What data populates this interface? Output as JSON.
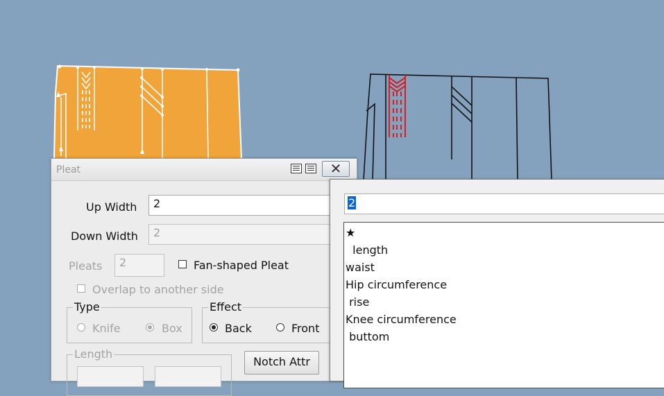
{
  "dialog": {
    "title": "Pleat",
    "up_width_label": "Up Width",
    "up_width_value": "2",
    "down_width_label": "Down Width",
    "down_width_value": "2",
    "pleats_label": "Pleats",
    "pleats_value": "2",
    "fan_shaped_label": "Fan-shaped Pleat",
    "overlap_label": "Overlap to another side",
    "type_label": "Type",
    "type_options": [
      "Knife",
      "Box"
    ],
    "type_selected": "Box",
    "effect_label": "Effect",
    "effect_options": [
      "Back",
      "Front"
    ],
    "effect_selected": "Back",
    "length_label": "Length",
    "notch_attr_label": "Notch Attr"
  },
  "popup": {
    "input_value": "2",
    "items": [
      "★",
      "  length",
      "waist",
      "Hip circumference",
      " rise",
      "Knee circumference",
      " buttom"
    ]
  },
  "colors": {
    "background": "#84a2bd",
    "orange_piece": "#f0a43a",
    "pleat_red": "#e01010",
    "selection": "#0a64d6"
  }
}
